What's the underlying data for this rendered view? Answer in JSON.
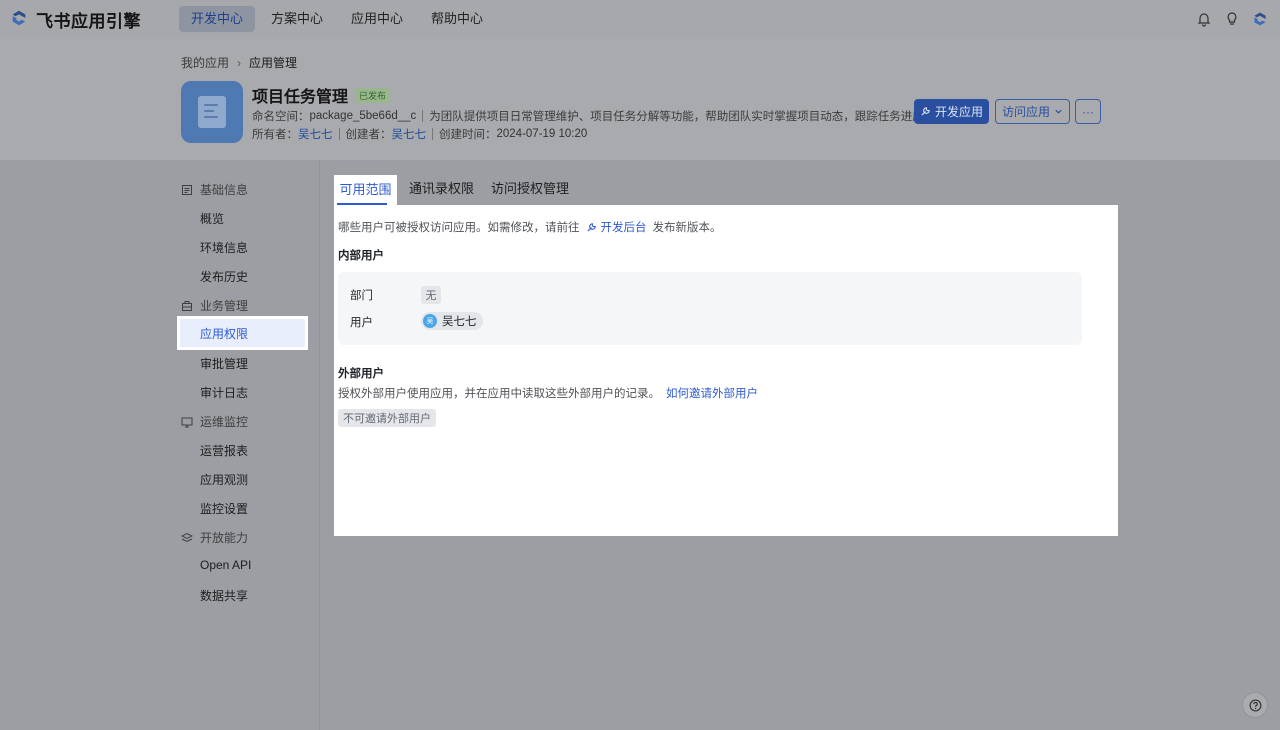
{
  "topnav": {
    "logo_text": "飞书应用引擎",
    "tabs": [
      {
        "label": "开发中心",
        "active": true
      },
      {
        "label": "方案中心",
        "active": false
      },
      {
        "label": "应用中心",
        "active": false
      },
      {
        "label": "帮助中心",
        "active": false
      }
    ],
    "right_icons": [
      "bell-icon",
      "bulb-icon",
      "brand-logo-icon"
    ]
  },
  "breadcrumb": {
    "parent": "我的应用",
    "current": "应用管理"
  },
  "app": {
    "name": "项目任务管理",
    "status_badge": "已发布",
    "namespace_label": "命名空间：",
    "namespace_value": "package_5be66d__c",
    "description": "为团队提供项目日常管理维护、项目任务分解等功能，帮助团队实时掌握项目动态，跟踪任务进度",
    "owner_label": "所有者：",
    "owner": "吴七七",
    "creator_label": "创建者：",
    "creator": "吴七七",
    "created_label": "创建时间：",
    "created_time": "2024-07-19 10:20"
  },
  "actions": {
    "develop_label": "开发应用",
    "visit_label": "访问应用",
    "more_label": "···"
  },
  "sidebar": {
    "groups": [
      {
        "label": "基础信息",
        "icon": "file-list-icon",
        "items": [
          "概览",
          "环境信息",
          "发布历史"
        ]
      },
      {
        "label": "业务管理",
        "icon": "briefcase-icon",
        "items": [
          "应用权限",
          "审批管理",
          "审计日志"
        ]
      },
      {
        "label": "运维监控",
        "icon": "monitor-icon",
        "items": [
          "运营报表",
          "应用观测",
          "监控设置"
        ]
      },
      {
        "label": "开放能力",
        "icon": "layers-icon",
        "items": [
          "Open API",
          "数据共享"
        ]
      }
    ],
    "active_item": "应用权限"
  },
  "content_tabs": [
    {
      "label": "可用范围",
      "active": true
    },
    {
      "label": "通讯录权限",
      "active": false
    },
    {
      "label": "访问授权管理",
      "active": false
    }
  ],
  "scope": {
    "desc_before": "哪些用户可被授权访问应用。如需修改，请前往",
    "desc_link": "开发后台",
    "desc_after": "发布新版本。",
    "internal_title": "内部用户",
    "department_label": "部门",
    "department_value": "无",
    "user_label": "用户",
    "user_avatar": "吴",
    "user_value": "吴七七",
    "external_title": "外部用户",
    "external_desc": "授权外部用户使用应用，并在应用中读取这些外部用户的记录。",
    "external_link": "如何邀请外部用户",
    "external_tag": "不可邀请外部用户"
  },
  "colors": {
    "accent": "#2f5bd0",
    "overlay": "#9c9ea3",
    "panel": "#ffffff"
  }
}
